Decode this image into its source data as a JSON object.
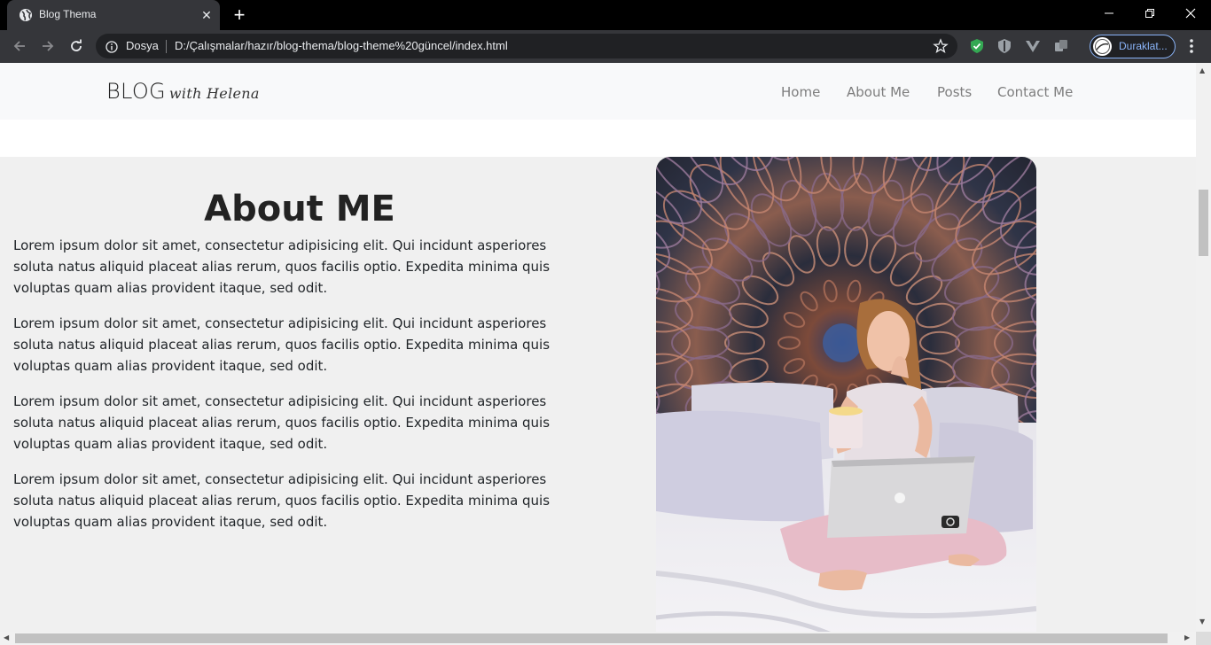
{
  "browser": {
    "tab_title": "Blog Thema",
    "tab_close": "✕",
    "new_tab": "+",
    "address_scheme": "Dosya",
    "address_url": "D:/Çalışmalar/hazır/blog-thema/blog-theme%20güncel/index.html",
    "profile_label": "Duraklat..."
  },
  "site": {
    "brand_main": "BLOG",
    "brand_sub": "with Helena",
    "nav": [
      "Home",
      "About Me",
      "Posts",
      "Contact Me"
    ]
  },
  "about": {
    "title": "About ME",
    "paragraphs": [
      "Lorem ipsum dolor sit amet, consectetur adipisicing elit. Qui incidunt asperiores soluta natus aliquid placeat alias rerum, quos facilis optio. Expedita minima quis voluptas quam alias provident itaque, sed odit.",
      "Lorem ipsum dolor sit amet, consectetur adipisicing elit. Qui incidunt asperiores soluta natus aliquid placeat alias rerum, quos facilis optio. Expedita minima quis voluptas quam alias provident itaque, sed odit.",
      "Lorem ipsum dolor sit amet, consectetur adipisicing elit. Qui incidunt asperiores soluta natus aliquid placeat alias rerum, quos facilis optio. Expedita minima quis voluptas quam alias provident itaque, sed odit.",
      "Lorem ipsum dolor sit amet, consectetur adipisicing elit. Qui incidunt asperiores soluta natus aliquid placeat alias rerum, quos facilis optio. Expedita minima quis voluptas quam alias provident itaque, sed odit."
    ]
  },
  "colors": {
    "chrome_dark": "#35363a",
    "navbar_bg": "#f8f9fa",
    "section_bg": "#f0f0f0",
    "profile_accent": "#8ab4f8"
  }
}
